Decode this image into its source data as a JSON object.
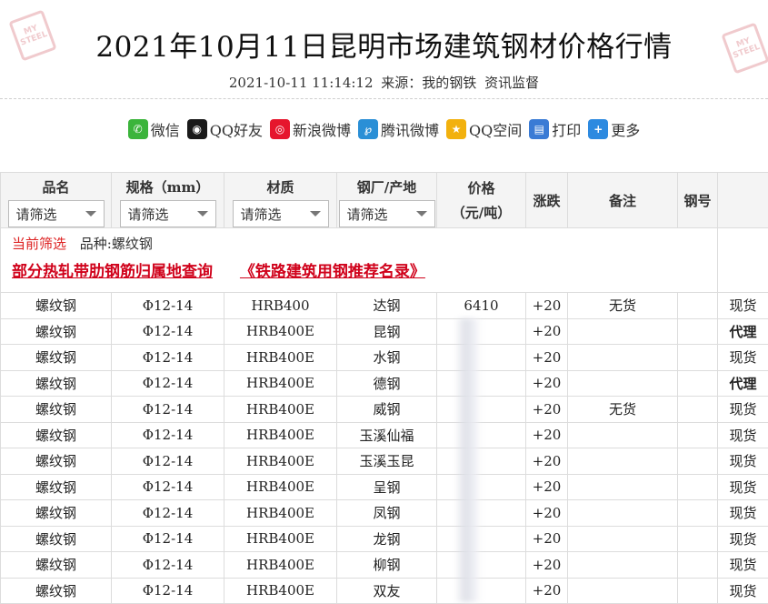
{
  "page": {
    "title": "2021年10月11日昆明市场建筑钢材价格行情",
    "datetime": "2021-10-11 11:14:12",
    "source_label": "来源：我的钢铁",
    "category": "资讯监督"
  },
  "share": [
    {
      "icon": "wechat-icon",
      "label": "微信",
      "color": "#3bb43b"
    },
    {
      "icon": "qq-icon",
      "label": "QQ好友",
      "color": "#1a1a1a"
    },
    {
      "icon": "weibo-icon",
      "label": "新浪微博",
      "color": "#e6162d"
    },
    {
      "icon": "tencent-weibo-icon",
      "label": "腾讯微博",
      "color": "#2a8fd6"
    },
    {
      "icon": "qzone-icon",
      "label": "QQ空间",
      "color": "#f2b10e"
    },
    {
      "icon": "print-icon",
      "label": "打印",
      "color": "#3a7bd5"
    },
    {
      "icon": "more-icon",
      "label": "更多",
      "color": "#2d8ae0"
    }
  ],
  "columns": {
    "name": "品名",
    "spec": "规格（mm）",
    "material": "材质",
    "mill": "钢厂/产地",
    "price": "价格",
    "price_unit": "（元/吨）",
    "change": "涨跌",
    "remark": "备注",
    "grade": "钢号"
  },
  "filter_placeholder": "请筛选",
  "current_filter": {
    "label": "当前筛选",
    "value": "品种:螺纹钢"
  },
  "links": [
    "部分热轧带肋钢筋归属地查询",
    "《铁路建筑用钢推荐名录》"
  ],
  "rows": [
    {
      "name": "螺纹钢",
      "spec": "Φ12-14",
      "material": "HRB400",
      "mill": "达钢",
      "price": "6410",
      "change": "+20",
      "remark": "无货",
      "grade": "",
      "status": "现货"
    },
    {
      "name": "螺纹钢",
      "spec": "Φ12-14",
      "material": "HRB400E",
      "mill": "昆钢",
      "price": "",
      "change": "+20",
      "remark": "",
      "grade": "",
      "status": "代理"
    },
    {
      "name": "螺纹钢",
      "spec": "Φ12-14",
      "material": "HRB400E",
      "mill": "水钢",
      "price": "",
      "change": "+20",
      "remark": "",
      "grade": "",
      "status": "现货"
    },
    {
      "name": "螺纹钢",
      "spec": "Φ12-14",
      "material": "HRB400E",
      "mill": "德钢",
      "price": "",
      "change": "+20",
      "remark": "",
      "grade": "",
      "status": "代理"
    },
    {
      "name": "螺纹钢",
      "spec": "Φ12-14",
      "material": "HRB400E",
      "mill": "威钢",
      "price": "",
      "change": "+20",
      "remark": "无货",
      "grade": "",
      "status": "现货"
    },
    {
      "name": "螺纹钢",
      "spec": "Φ12-14",
      "material": "HRB400E",
      "mill": "玉溪仙福",
      "price": "",
      "change": "+20",
      "remark": "",
      "grade": "",
      "status": "现货"
    },
    {
      "name": "螺纹钢",
      "spec": "Φ12-14",
      "material": "HRB400E",
      "mill": "玉溪玉昆",
      "price": "",
      "change": "+20",
      "remark": "",
      "grade": "",
      "status": "现货"
    },
    {
      "name": "螺纹钢",
      "spec": "Φ12-14",
      "material": "HRB400E",
      "mill": "呈钢",
      "price": "",
      "change": "+20",
      "remark": "",
      "grade": "",
      "status": "现货"
    },
    {
      "name": "螺纹钢",
      "spec": "Φ12-14",
      "material": "HRB400E",
      "mill": "凤钢",
      "price": "",
      "change": "+20",
      "remark": "",
      "grade": "",
      "status": "现货"
    },
    {
      "name": "螺纹钢",
      "spec": "Φ12-14",
      "material": "HRB400E",
      "mill": "龙钢",
      "price": "",
      "change": "+20",
      "remark": "",
      "grade": "",
      "status": "现货"
    },
    {
      "name": "螺纹钢",
      "spec": "Φ12-14",
      "material": "HRB400E",
      "mill": "柳钢",
      "price": "",
      "change": "+20",
      "remark": "",
      "grade": "",
      "status": "现货"
    },
    {
      "name": "螺纹钢",
      "spec": "Φ12-14",
      "material": "HRB400E",
      "mill": "双友",
      "price": "",
      "change": "+20",
      "remark": "",
      "grade": "",
      "status": "现货"
    }
  ],
  "colors": {
    "link_red": "#d0021b",
    "link_blue": "#3355aa"
  }
}
